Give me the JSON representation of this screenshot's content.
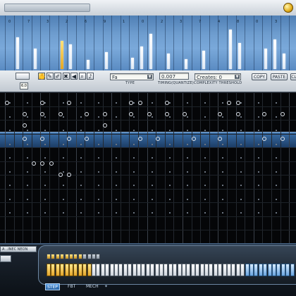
{
  "app": {
    "name": "",
    "accent": "#e3a623",
    "highlight": "#3b6fa8"
  },
  "velocity_lane": {
    "scale_ticks": [
      "0",
      "7",
      "3",
      "2",
      "6",
      "9",
      "1",
      "0",
      "2",
      "3",
      "7",
      "4",
      "8",
      "0",
      "3"
    ],
    "bars": [
      {
        "step": 1,
        "value": 0.62,
        "selected": false
      },
      {
        "step": 3,
        "value": 0.4,
        "selected": false
      },
      {
        "step": 6,
        "value": 0.55,
        "selected": true
      },
      {
        "step": 7,
        "value": 0.48,
        "selected": false
      },
      {
        "step": 9,
        "value": 0.18,
        "selected": false
      },
      {
        "step": 11,
        "value": 0.34,
        "selected": false
      },
      {
        "step": 14,
        "value": 0.22,
        "selected": false
      },
      {
        "step": 15,
        "value": 0.45,
        "selected": false
      },
      {
        "step": 16,
        "value": 0.7,
        "selected": false
      },
      {
        "step": 18,
        "value": 0.3,
        "selected": false
      },
      {
        "step": 20,
        "value": 0.2,
        "selected": false
      },
      {
        "step": 22,
        "value": 0.36,
        "selected": false
      },
      {
        "step": 25,
        "value": 0.78,
        "selected": false
      },
      {
        "step": 26,
        "value": 0.52,
        "selected": false
      },
      {
        "step": 29,
        "value": 0.4,
        "selected": false
      },
      {
        "step": 30,
        "value": 0.58,
        "selected": false
      },
      {
        "step": 31,
        "value": 0.3,
        "selected": false
      }
    ]
  },
  "controls": {
    "left_value": "6.0",
    "tools": [
      {
        "icon": "hand-icon",
        "glyph": "✋",
        "active": true
      },
      {
        "icon": "pencil-icon",
        "glyph": "✎",
        "active": false
      },
      {
        "icon": "brush-icon",
        "glyph": "✐",
        "active": false
      },
      {
        "icon": "eraser-icon",
        "glyph": "✖",
        "active": false
      },
      {
        "icon": "mute-icon",
        "glyph": "◀",
        "active": false
      },
      {
        "icon": "zoom-icon",
        "glyph": "⌕",
        "active": false
      },
      {
        "icon": "speaker-icon",
        "glyph": "♪",
        "active": false
      }
    ],
    "type": {
      "value": "Fa",
      "label": "TYPE"
    },
    "timing": {
      "value": "0.007",
      "label": "TIMING(QUANTIZE)"
    },
    "complexity": {
      "value": "Creates: 0",
      "label": "COMPLEXITY THRESHOLD"
    },
    "buttons": [
      "COPY",
      "PASTE",
      "CLEAR"
    ]
  },
  "grid": {
    "columns": 32,
    "highlight_row": "row-4",
    "notes": [
      {
        "row": 0,
        "step": 0,
        "dim": false
      },
      {
        "row": 0,
        "step": 4,
        "dim": false
      },
      {
        "row": 0,
        "step": 7,
        "dim": false
      },
      {
        "row": 0,
        "step": 14,
        "dim": false
      },
      {
        "row": 0,
        "step": 15,
        "dim": false
      },
      {
        "row": 0,
        "step": 18,
        "dim": false
      },
      {
        "row": 0,
        "step": 25,
        "dim": false
      },
      {
        "row": 0,
        "step": 26,
        "dim": false
      },
      {
        "row": 1,
        "step": 2,
        "dim": false
      },
      {
        "row": 1,
        "step": 4,
        "dim": false
      },
      {
        "row": 1,
        "step": 6,
        "dim": false
      },
      {
        "row": 1,
        "step": 9,
        "dim": false
      },
      {
        "row": 1,
        "step": 11,
        "dim": false
      },
      {
        "row": 1,
        "step": 14,
        "dim": false
      },
      {
        "row": 1,
        "step": 16,
        "dim": false
      },
      {
        "row": 1,
        "step": 18,
        "dim": false
      },
      {
        "row": 1,
        "step": 20,
        "dim": false
      },
      {
        "row": 1,
        "step": 24,
        "dim": false
      },
      {
        "row": 1,
        "step": 26,
        "dim": false
      },
      {
        "row": 1,
        "step": 29,
        "dim": false
      },
      {
        "row": 1,
        "step": 31,
        "dim": false
      },
      {
        "row": 2,
        "step": 2,
        "dim": false
      },
      {
        "row": 2,
        "step": 11,
        "dim": false
      },
      {
        "row": 3,
        "step": 2,
        "dim": false
      },
      {
        "row": 3,
        "step": 4,
        "dim": false
      },
      {
        "row": 3,
        "step": 7,
        "dim": false
      },
      {
        "row": 3,
        "step": 9,
        "dim": false
      },
      {
        "row": 3,
        "step": 15,
        "dim": false
      },
      {
        "row": 3,
        "step": 17,
        "dim": false
      },
      {
        "row": 3,
        "step": 21,
        "dim": false
      },
      {
        "row": 3,
        "step": 24,
        "dim": false
      },
      {
        "row": 3,
        "step": 29,
        "dim": false
      },
      {
        "row": 3,
        "step": 31,
        "dim": false
      },
      {
        "row": 6,
        "step": 3,
        "dim": false
      },
      {
        "row": 6,
        "step": 4,
        "dim": false
      },
      {
        "row": 6,
        "step": 5,
        "dim": false
      },
      {
        "row": 7,
        "step": 6,
        "dim": false
      },
      {
        "row": 7,
        "step": 7,
        "dim": false
      }
    ]
  },
  "bottom_panel": {
    "left_label": "A ..INEC NEON",
    "footer_tabs": [
      {
        "label": "STEP",
        "active": true
      },
      {
        "label": "FBT",
        "active": false
      },
      {
        "label": "MECH",
        "active": false
      }
    ],
    "keys": {
      "count": 55,
      "yellow_count": 10,
      "blue_start": 44
    }
  }
}
